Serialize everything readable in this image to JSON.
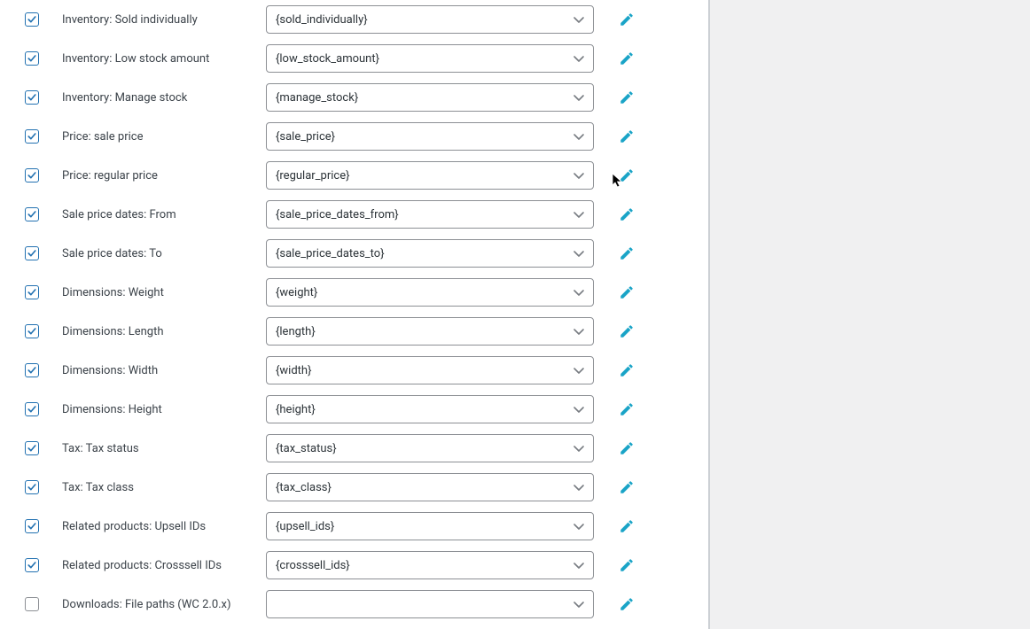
{
  "fields": [
    {
      "label": "Inventory: Sold individually",
      "value": "{sold_individually}",
      "checked": true
    },
    {
      "label": "Inventory: Low stock amount",
      "value": "{low_stock_amount}",
      "checked": true
    },
    {
      "label": "Inventory: Manage stock",
      "value": "{manage_stock}",
      "checked": true
    },
    {
      "label": "Price: sale price",
      "value": "{sale_price}",
      "checked": true
    },
    {
      "label": "Price: regular price",
      "value": "{regular_price}",
      "checked": true
    },
    {
      "label": "Sale price dates: From",
      "value": "{sale_price_dates_from}",
      "checked": true
    },
    {
      "label": "Sale price dates: To",
      "value": "{sale_price_dates_to}",
      "checked": true
    },
    {
      "label": "Dimensions: Weight",
      "value": "{weight}",
      "checked": true
    },
    {
      "label": "Dimensions: Length",
      "value": "{length}",
      "checked": true
    },
    {
      "label": "Dimensions: Width",
      "value": "{width}",
      "checked": true
    },
    {
      "label": "Dimensions: Height",
      "value": "{height}",
      "checked": true
    },
    {
      "label": "Tax: Tax status",
      "value": "{tax_status}",
      "checked": true
    },
    {
      "label": "Tax: Tax class",
      "value": "{tax_class}",
      "checked": true
    },
    {
      "label": "Related products: Upsell IDs",
      "value": "{upsell_ids}",
      "checked": true
    },
    {
      "label": "Related products: Crosssell IDs",
      "value": "{crosssell_ids}",
      "checked": true
    },
    {
      "label": "Downloads: File paths (WC 2.0.x)",
      "value": "",
      "checked": false
    }
  ]
}
